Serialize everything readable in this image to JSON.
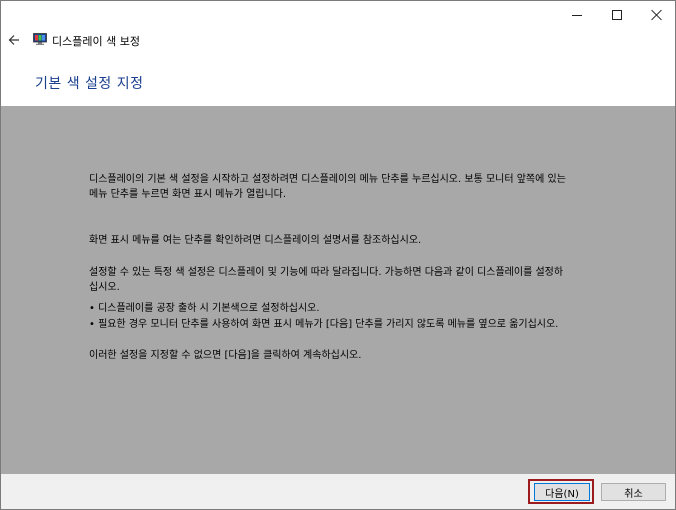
{
  "window": {
    "title": "디스플레이 색 보정",
    "heading": "기본 색 설정 지정"
  },
  "content": {
    "paragraph1": "디스플레이의 기본 색 설정을 시작하고 설정하려면 디스플레이의 메뉴 단추를 누르십시오. 보통 모니터 앞쪽에 있는 메뉴 단추를 누르면 화면 표시 메뉴가 열립니다.",
    "paragraph2": "화면 표시 메뉴를 여는 단추를 확인하려면 디스플레이의 설명서를 참조하십시오.",
    "paragraph3": "설정할 수 있는 특정 색 설정은 디스플레이 및 기능에 따라 달라집니다. 가능하면 다음과 같이 디스플레이를 설정하십시오.",
    "bullet1": "• 디스플레이를 공장 출하 시 기본색으로 설정하십시오.",
    "bullet2": "• 필요한 경우 모니터 단추를 사용하여 화면 표시 메뉴가 [다음] 단추를 가리지 않도록 메뉴를 옆으로 옮기십시오.",
    "paragraph4": "이러한 설정을 지정할 수 없으면 [다음]을 클릭하여 계속하십시오."
  },
  "footer": {
    "next_label": "다음(N)",
    "cancel_label": "취소"
  },
  "colors": {
    "content_bg": "#a8a8a8",
    "heading": "#1a3f8f",
    "highlight": "#9b1b1f"
  }
}
